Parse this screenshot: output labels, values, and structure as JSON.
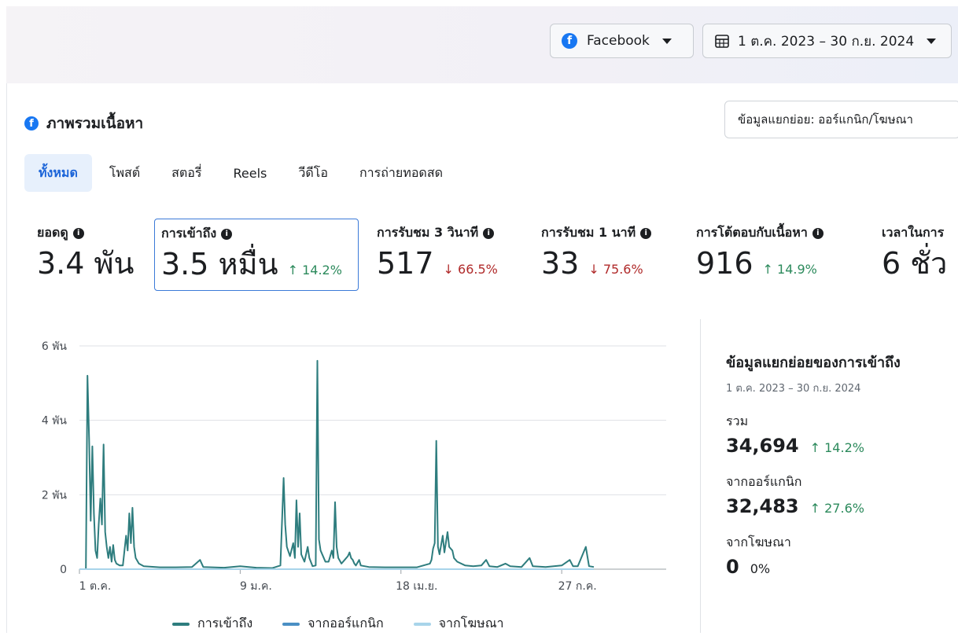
{
  "header": {
    "platform_label": "Facebook",
    "date_range_label": "1 ต.ค. 2023 – 30 ก.ย. 2024"
  },
  "section": {
    "title": "ภาพรวมเนื้อหา",
    "breakdown_button": "ข้อมูลแยกย่อย: ออร์แกนิก/โฆษณา"
  },
  "tabs": [
    {
      "label": "ทั้งหมด",
      "active": true
    },
    {
      "label": "โพสต์"
    },
    {
      "label": "สตอรี่"
    },
    {
      "label": "Reels"
    },
    {
      "label": "วีดีโอ"
    },
    {
      "label": "การถ่ายทอดสด"
    }
  ],
  "metrics": [
    {
      "label": "ยอดดู",
      "value": "3.4 พัน",
      "change": ""
    },
    {
      "label": "การเข้าถึง",
      "value": "3.5 หมื่น",
      "change": "↑ 14.2%",
      "direction": "up",
      "selected": true
    },
    {
      "label": "การรับชม 3 วินาที",
      "value": "517",
      "change": "↓ 66.5%",
      "direction": "down"
    },
    {
      "label": "การรับชม 1 นาที",
      "value": "33",
      "change": "↓ 75.6%",
      "direction": "down"
    },
    {
      "label": "การโต้ตอบกับเนื้อหา",
      "value": "916",
      "change": "↑ 14.9%",
      "direction": "up"
    },
    {
      "label": "เวลาในการ",
      "value": "6 ชั่ว",
      "change": ""
    }
  ],
  "side_panel": {
    "title": "ข้อมูลแยกย่อยของการเข้าถึง",
    "date_range": "1 ต.ค. 2023 – 30 ก.ย. 2024",
    "total_label": "รวม",
    "total_value": "34,694",
    "total_change": "↑ 14.2%",
    "organic_label": "จากออร์แกนิก",
    "organic_value": "32,483",
    "organic_change": "↑ 27.6%",
    "ads_label": "จากโฆษณา",
    "ads_value": "0",
    "ads_change": "0%"
  },
  "colors": {
    "reach": "#2e7d7e",
    "organic": "#4a8fc4",
    "ads": "#a8d4ea",
    "up": "#2c8a5c",
    "down": "#b02a2a",
    "accent": "#1877f2"
  },
  "chart_data": {
    "type": "line",
    "y_ticks": [
      "0",
      "2 พัน",
      "4 พัน",
      "6 พัน"
    ],
    "x_ticks": [
      "1 ต.ค.",
      "9 ม.ค.",
      "18 เม.ย.",
      "27 ก.ค."
    ],
    "ylim": [
      0,
      6000
    ],
    "x_range_days": [
      0,
      365
    ],
    "grid": true,
    "legend_position": "bottom",
    "series": [
      {
        "name": "การเข้าถึง",
        "color": "#2e7d7e",
        "points": [
          [
            0,
            0
          ],
          [
            4,
            0
          ],
          [
            5,
            5200
          ],
          [
            6,
            3500
          ],
          [
            7,
            1300
          ],
          [
            8,
            3300
          ],
          [
            9,
            1500
          ],
          [
            10,
            500
          ],
          [
            11,
            300
          ],
          [
            12,
            1200
          ],
          [
            13,
            1900
          ],
          [
            14,
            1200
          ],
          [
            15,
            3350
          ],
          [
            16,
            1000
          ],
          [
            17,
            600
          ],
          [
            18,
            300
          ],
          [
            19,
            600
          ],
          [
            20,
            200
          ],
          [
            21,
            650
          ],
          [
            22,
            250
          ],
          [
            23,
            150
          ],
          [
            25,
            100
          ],
          [
            27,
            100
          ],
          [
            29,
            900
          ],
          [
            30,
            500
          ],
          [
            31,
            1500
          ],
          [
            32,
            700
          ],
          [
            33,
            1650
          ],
          [
            34,
            600
          ],
          [
            35,
            300
          ],
          [
            37,
            150
          ],
          [
            40,
            80
          ],
          [
            50,
            50
          ],
          [
            60,
            50
          ],
          [
            70,
            60
          ],
          [
            75,
            250
          ],
          [
            77,
            60
          ],
          [
            90,
            40
          ],
          [
            100,
            80
          ],
          [
            110,
            40
          ],
          [
            120,
            30
          ],
          [
            125,
            100
          ],
          [
            127,
            2450
          ],
          [
            128,
            1200
          ],
          [
            129,
            600
          ],
          [
            131,
            350
          ],
          [
            133,
            700
          ],
          [
            134,
            300
          ],
          [
            135,
            1850
          ],
          [
            136,
            600
          ],
          [
            137,
            1500
          ],
          [
            138,
            400
          ],
          [
            140,
            200
          ],
          [
            142,
            600
          ],
          [
            143,
            300
          ],
          [
            145,
            80
          ],
          [
            147,
            100
          ],
          [
            148,
            5600
          ],
          [
            149,
            800
          ],
          [
            150,
            500
          ],
          [
            152,
            300
          ],
          [
            153,
            200
          ],
          [
            155,
            200
          ],
          [
            157,
            500
          ],
          [
            158,
            300
          ],
          [
            159,
            1800
          ],
          [
            160,
            600
          ],
          [
            161,
            300
          ],
          [
            163,
            150
          ],
          [
            165,
            250
          ],
          [
            167,
            350
          ],
          [
            168,
            450
          ],
          [
            169,
            300
          ],
          [
            170,
            250
          ],
          [
            171,
            150
          ],
          [
            172,
            100
          ],
          [
            174,
            250
          ],
          [
            175,
            100
          ],
          [
            180,
            60
          ],
          [
            190,
            50
          ],
          [
            200,
            50
          ],
          [
            210,
            50
          ],
          [
            218,
            150
          ],
          [
            219,
            250
          ],
          [
            220,
            550
          ],
          [
            221,
            700
          ],
          [
            222,
            3450
          ],
          [
            223,
            600
          ],
          [
            224,
            400
          ],
          [
            226,
            900
          ],
          [
            227,
            450
          ],
          [
            229,
            1000
          ],
          [
            230,
            600
          ],
          [
            232,
            500
          ],
          [
            233,
            300
          ],
          [
            235,
            200
          ],
          [
            240,
            100
          ],
          [
            245,
            80
          ],
          [
            250,
            100
          ],
          [
            253,
            250
          ],
          [
            255,
            80
          ],
          [
            260,
            60
          ],
          [
            265,
            150
          ],
          [
            268,
            80
          ],
          [
            275,
            60
          ],
          [
            280,
            300
          ],
          [
            282,
            80
          ],
          [
            290,
            60
          ],
          [
            300,
            100
          ],
          [
            305,
            250
          ],
          [
            307,
            80
          ],
          [
            310,
            80
          ],
          [
            315,
            600
          ],
          [
            317,
            80
          ],
          [
            320,
            60
          ]
        ]
      },
      {
        "name": "จากออร์แกนิก",
        "color": "#4a8fc4",
        "points": []
      },
      {
        "name": "จากโฆษณา",
        "color": "#a8d4ea",
        "points": [
          [
            0,
            0
          ],
          [
            320,
            0
          ]
        ]
      }
    ]
  }
}
